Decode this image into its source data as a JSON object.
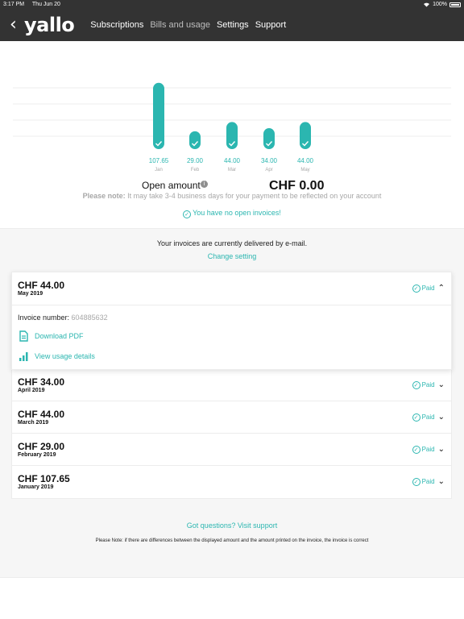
{
  "statusbar": {
    "time": "3:17 PM",
    "date": "Thu Jun 20",
    "battery": "100%"
  },
  "header": {
    "back_glyph": "‹",
    "logo": "yallo",
    "nav": [
      "Subscriptions",
      "Bills and usage",
      "Settings",
      "Support"
    ]
  },
  "chart_data": {
    "type": "bar",
    "categories": [
      "Jan",
      "Feb",
      "Mar",
      "Apr",
      "May"
    ],
    "values": [
      107.65,
      29.0,
      44.0,
      34.0,
      44.0
    ],
    "value_labels": [
      "107.65",
      "29.00",
      "44.00",
      "34.00",
      "44.00"
    ],
    "ylim": [
      0,
      110
    ],
    "grid": true,
    "bar_color": "#2bb6b0"
  },
  "summary": {
    "open_amount_label": "Open amount",
    "info_glyph": "i",
    "open_amount_value": "CHF 0.00",
    "note_prefix": "Please note:",
    "note_text": " It may take 3-4 business days for your payment to be reflected on your account",
    "no_invoices": "You have no open invoices!"
  },
  "delivery": {
    "text": "Your invoices are currently delivered by e-mail.",
    "change_link": "Change setting"
  },
  "invoices": [
    {
      "amount": "CHF 44.00",
      "date": "May 2019",
      "status": "Paid",
      "expanded": true
    },
    {
      "amount": "CHF 34.00",
      "date": "April 2019",
      "status": "Paid",
      "expanded": false
    },
    {
      "amount": "CHF 44.00",
      "date": "March 2019",
      "status": "Paid",
      "expanded": false
    },
    {
      "amount": "CHF 29.00",
      "date": "February 2019",
      "status": "Paid",
      "expanded": false
    },
    {
      "amount": "CHF 107.65",
      "date": "January 2019",
      "status": "Paid",
      "expanded": false
    }
  ],
  "invoice_detail": {
    "number_label": "Invoice number: ",
    "number_value": "604885632",
    "download_pdf": "Download PDF",
    "view_usage": "View usage details"
  },
  "footer": {
    "questions_link": "Got questions? Visit support",
    "footnote": "Please Note: if there are differences between the displayed amount and the amount printed on the invoice, the invoice is correct"
  },
  "colors": {
    "accent": "#2bb6b0",
    "header_bg": "#333333",
    "muted": "#a7a7a7"
  }
}
